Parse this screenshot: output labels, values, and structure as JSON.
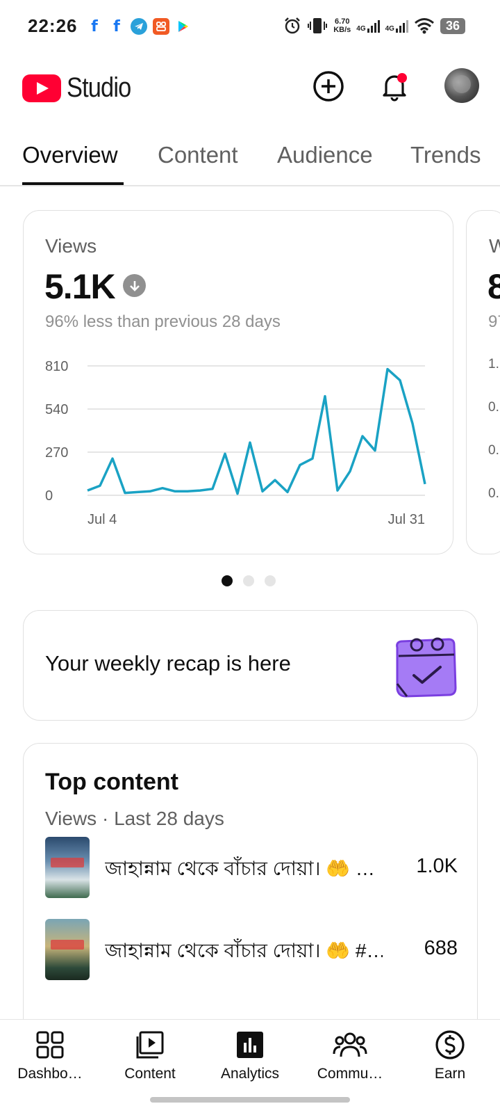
{
  "status_bar": {
    "time": "22:26",
    "net_speed_value": "6.70",
    "net_speed_unit": "KB/s",
    "sim1": "4G",
    "sim2": "4G",
    "battery": "36"
  },
  "header": {
    "logo_text": "Studio",
    "brand_color": "#ff0033"
  },
  "tabs": [
    {
      "label": "Overview",
      "active": true
    },
    {
      "label": "Content",
      "active": false
    },
    {
      "label": "Audience",
      "active": false
    },
    {
      "label": "Trends",
      "active": false
    }
  ],
  "views_card": {
    "label": "Views",
    "value": "5.1K",
    "comparison": "96% less than previous 28 days",
    "accent_color": "#1aa2c4"
  },
  "chart_data": {
    "type": "line",
    "title": "",
    "xlabel": "",
    "ylabel": "",
    "y_ticks": [
      "810",
      "540",
      "270",
      "0"
    ],
    "x_tick_labels": [
      "Jul 4",
      "Jul 31"
    ],
    "ylim": [
      0,
      810
    ],
    "x": [
      "Jul 4",
      "Jul 5",
      "Jul 6",
      "Jul 7",
      "Jul 8",
      "Jul 9",
      "Jul 10",
      "Jul 11",
      "Jul 12",
      "Jul 13",
      "Jul 14",
      "Jul 15",
      "Jul 16",
      "Jul 17",
      "Jul 18",
      "Jul 19",
      "Jul 20",
      "Jul 21",
      "Jul 22",
      "Jul 23",
      "Jul 24",
      "Jul 25",
      "Jul 26",
      "Jul 27",
      "Jul 28",
      "Jul 29",
      "Jul 30",
      "Jul 31"
    ],
    "series": [
      {
        "values": [
          30,
          60,
          230,
          15,
          20,
          25,
          45,
          25,
          25,
          30,
          40,
          260,
          10,
          330,
          25,
          95,
          20,
          190,
          230,
          620,
          30,
          150,
          370,
          280,
          790,
          720,
          450,
          70
        ]
      }
    ],
    "grid": true
  },
  "peek_card": {
    "label": "W",
    "value": "8",
    "comparison": "97",
    "ticks": [
      "1.",
      "0.",
      "0.",
      "0."
    ]
  },
  "carousel": {
    "count": 3,
    "active": 0
  },
  "recap": {
    "text": "Your weekly recap is here",
    "icon": "calendar-check-icon"
  },
  "top_content": {
    "title": "Top content",
    "subtitle": "Views · Last 28 days",
    "items": [
      {
        "title": "জাহান্নাম থেকে বাঁচার দোয়া। 🤲 …",
        "views": "1.0K"
      },
      {
        "title": "জাহান্নাম থেকে বাঁচার দোয়া। 🤲 #…",
        "views": "688"
      }
    ]
  },
  "bottom_nav": [
    {
      "label": "Dashbo…",
      "icon": "dashboard-icon"
    },
    {
      "label": "Content",
      "icon": "content-icon"
    },
    {
      "label": "Analytics",
      "icon": "analytics-icon",
      "active": true
    },
    {
      "label": "Commu…",
      "icon": "community-icon"
    },
    {
      "label": "Earn",
      "icon": "earn-icon"
    }
  ]
}
